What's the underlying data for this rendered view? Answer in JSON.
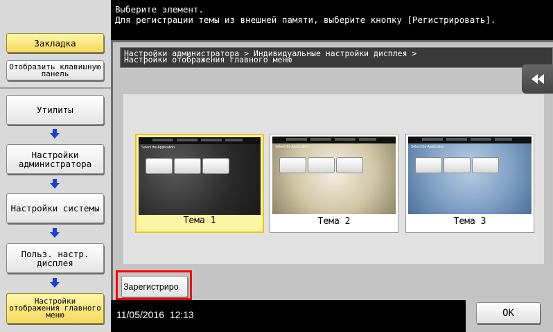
{
  "message": {
    "line1": "Выберите элемент.",
    "line2": "Для регистрации темы из внешней памяти, выберите кнопку [Регистрировать]."
  },
  "sidebar": {
    "bookmark": "Закладка",
    "show_keypad": "Отобразить клавишную панель",
    "steps": [
      {
        "label": "Утилиты"
      },
      {
        "label": "Настройки администратора"
      },
      {
        "label": "Настройки системы"
      },
      {
        "label": "Польз. настр. дисплея"
      },
      {
        "label": "Настройки отображения главного меню"
      }
    ]
  },
  "breadcrumb": {
    "line1": "Настройки администратора > Индивидуальные настройки дисплея >",
    "line2": "Настройки отображения главного меню"
  },
  "themes": [
    {
      "label": "Тема 1",
      "preview_title": "Select the Application",
      "selected": true
    },
    {
      "label": "Тема 2",
      "preview_title": "Select the Application",
      "selected": false
    },
    {
      "label": "Тема 3",
      "preview_title": "Select the Application",
      "selected": false
    }
  ],
  "register_button": "Зарегистриро",
  "status": {
    "date": "11/05/2016",
    "time": "12:13"
  },
  "ok_button": "OK",
  "colors": {
    "highlight": "#ff0000",
    "selected_theme_border": "#e6c51a",
    "selected_theme_bg": "#fbf4a2",
    "step_arrow": "#1a3fd6"
  },
  "icons": {
    "collapse": "double-left-arrow-icon",
    "step_arrow": "down-arrow-icon"
  }
}
